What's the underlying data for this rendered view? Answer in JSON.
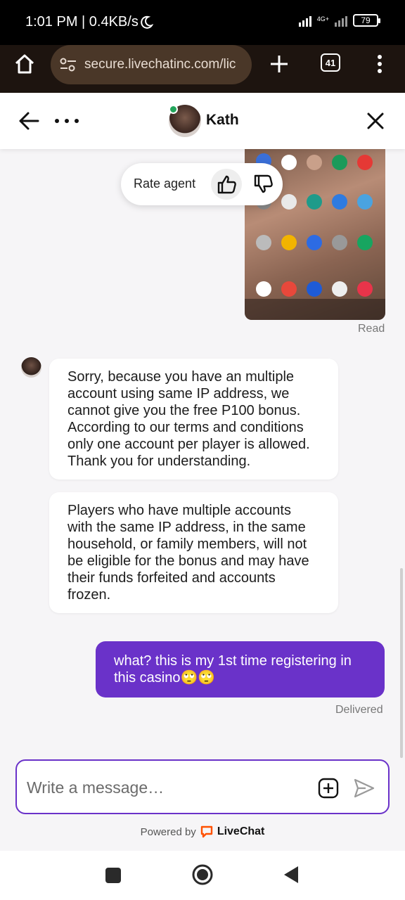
{
  "status_bar": {
    "time": "1:01 PM | 0.4KB/s",
    "network": "4G+",
    "battery": "79"
  },
  "browser": {
    "url": "secure.livechatinc.com/lic",
    "tab_count": "41"
  },
  "chat_header": {
    "agent_name": "Kath"
  },
  "rating": {
    "label": "Rate agent"
  },
  "messages": {
    "image_status": "Read",
    "agent_message_1": "Sorry, because you have an multiple account using same IP address, we cannot give you the free P100 bonus. According to our terms and conditions only one account per player is allowed. Thank you for understanding.",
    "agent_message_2": "Players who have multiple accounts with the same IP address, in the same household, or family members, will not be eligible for the bonus and may have their funds forfeited and accounts frozen.",
    "user_message": "what? this is my 1st time registering in this casino🙄🙄",
    "user_status": "Delivered"
  },
  "composer": {
    "placeholder": "Write a message…"
  },
  "footer": {
    "powered_by": "Powered by",
    "brand": "LiveChat"
  },
  "colors": {
    "accent": "#6a32c9",
    "online": "#22a55b",
    "brand_orange": "#ff5100"
  }
}
